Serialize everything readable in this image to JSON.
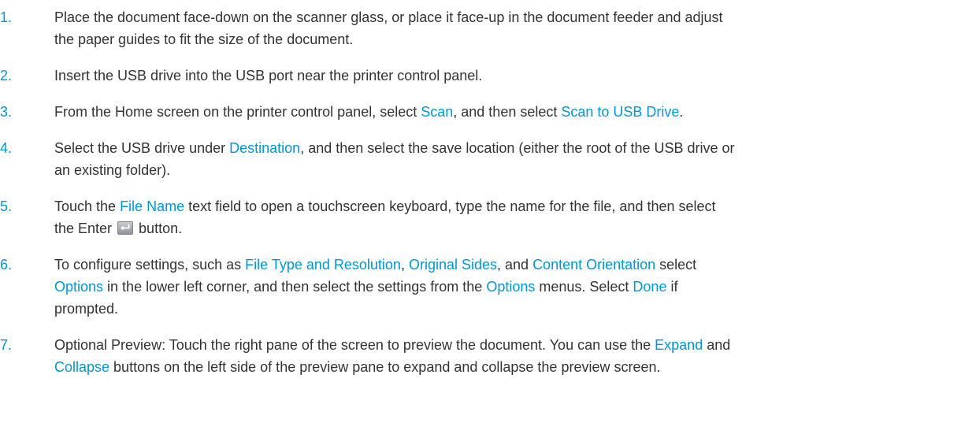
{
  "colors": {
    "accent": "#0096d6",
    "text": "#333333"
  },
  "steps": [
    {
      "number": "1.",
      "lines": [
        "Place the document face-down on the scanner glass, or place it face-up in the document feeder and adjust",
        "the paper guides to fit the size of the document."
      ]
    },
    {
      "number": "2.",
      "text": "Insert the USB drive into the USB port near the printer control panel."
    },
    {
      "number": "3.",
      "parts": [
        "From the Home screen on the printer control panel, select ",
        "Scan",
        ", and then select ",
        "Scan to USB Drive",
        "."
      ]
    },
    {
      "number": "4.",
      "parts": [
        "Select the USB drive under ",
        "Destination",
        ", and then select the save location (either the root of the USB drive or",
        "an existing folder)."
      ]
    },
    {
      "number": "5.",
      "parts": [
        "Touch the ",
        "File Name",
        " text field to open a touchscreen keyboard, type the name for the file, and then select",
        "the Enter ",
        " button."
      ],
      "icon": "enter-key-icon"
    },
    {
      "number": "6.",
      "parts": [
        "To configure settings, such as ",
        "File Type and Resolution",
        ", ",
        "Original Sides",
        ", and ",
        "Content Orientation",
        " select",
        "Options",
        " in the lower left corner, and then select the settings from the ",
        "Options",
        " menus. Select ",
        "Done",
        " if",
        "prompted."
      ]
    },
    {
      "number": "7.",
      "parts": [
        "Optional Preview: Touch the right pane of the screen to preview the document. You can use the ",
        "Expand",
        " and",
        "Collapse",
        " buttons on the left side of the preview pane to expand and collapse the preview screen."
      ]
    }
  ]
}
